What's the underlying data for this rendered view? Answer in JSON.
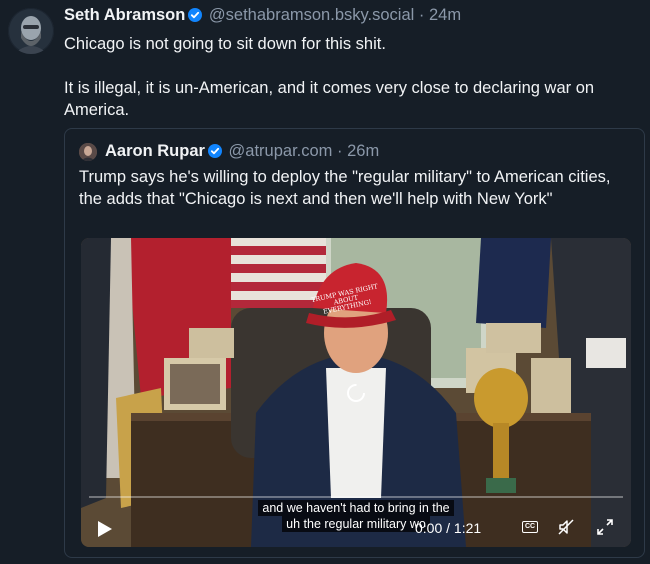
{
  "post": {
    "author_name": "Seth Abramson",
    "handle": "@sethabramson.bsky.social",
    "separator": "·",
    "time": "24m",
    "paragraphs": [
      "Chicago is not going to sit down for this shit.",
      "It is illegal, it is un-American, and it comes very close to declaring war on America."
    ]
  },
  "quote": {
    "author_name": "Aaron Rupar",
    "handle": "@atrupar.com",
    "separator": "·",
    "time": "26m",
    "text": "Trump says he's willing to deploy the \"regular military\" to American cities, the adds that \"Chicago is next and then we'll help with New York\""
  },
  "video": {
    "caption_line1": "and we haven't had to bring in the",
    "caption_line2": "uh the regular military wo",
    "timer": "0:00 / 1:21",
    "cc_label": "CC",
    "hat_text": "TRUMP WAS RIGHT ABOUT EVERYTHING!",
    "progress": 0
  },
  "colors": {
    "background": "#161e27",
    "verified": "#1185fe",
    "muted_text": "#8b98a9",
    "border": "#2e3a48"
  }
}
